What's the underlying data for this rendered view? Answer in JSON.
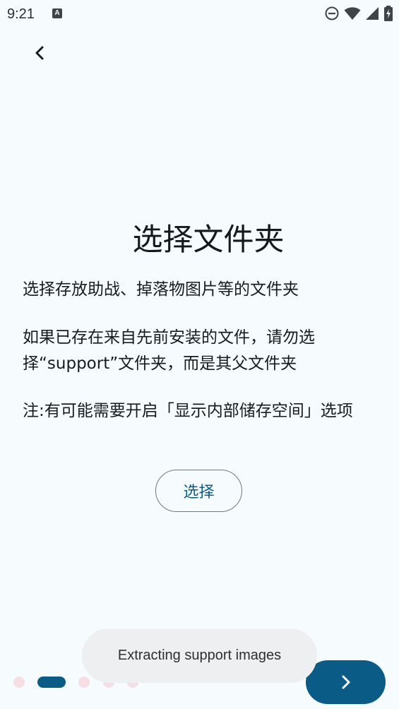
{
  "status_bar": {
    "time": "9:21",
    "notification_icon": "A",
    "icons": [
      "do-not-disturb-icon",
      "wifi-icon",
      "cell-signal-icon",
      "battery-charging-icon"
    ]
  },
  "nav": {
    "back_icon": "chevron-left-icon"
  },
  "content": {
    "title": "选择文件夹",
    "paragraph1": "选择存放助战、掉落物图片等的文件夹",
    "paragraph2": "如果已存在来自先前安装的文件，请勿选择“support”文件夹，而是其父文件夹",
    "paragraph3": "注:有可能需要开启「显示内部储存空间」选项",
    "select_button_label": "选择"
  },
  "toast": {
    "message": "Extracting support images"
  },
  "pager": {
    "total_pages": 5,
    "current_page": 2
  },
  "next_button": {
    "icon": "chevron-right-icon"
  },
  "colors": {
    "background": "#f6fbfe",
    "accent": "#0a5b86",
    "inactive_dot": "#f6dfe4",
    "toast_bg": "#eeeff0"
  }
}
